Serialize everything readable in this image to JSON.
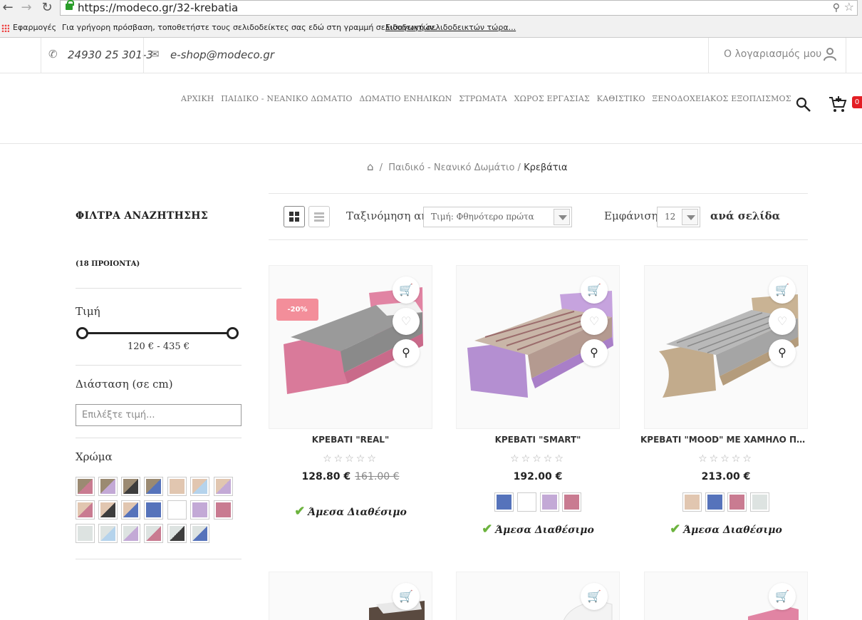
{
  "browser": {
    "url": "https://modeco.gr/32-krebatia",
    "apps_label": "Εφαρμογές",
    "bookmarks_hint": "Για γρήγορη πρόσβαση, τοποθετήστε τους σελιδοδείκτες σας εδώ στη γραμμή σελιδοδεικτών.",
    "bookmarks_link": "Εισαγωγή σελιδοδεικτών τώρα..."
  },
  "topbar": {
    "phone": "24930 25 301-3",
    "email": "e-shop@modeco.gr",
    "account": "Ο λογαριασμός μου"
  },
  "menu": [
    "ΑΡΧΙΚΗ",
    "ΠΑΙΔΙΚΟ - ΝΕΑΝΙΚΟ ΔΩΜΑΤΙΟ",
    "ΔΩΜΑΤΙΟ ΕΝΗΛΙΚΩΝ",
    "ΣΤΡΩΜΑΤΑ",
    "ΧΩΡΟΣ ΕΡΓΑΣΙΑΣ",
    "ΚΑΘΙΣΤΙΚΟ",
    "ΞΕΝΟΔΟΧΕΙΑΚΟΣ ΕΞΟΠΛΙΣΜΟΣ"
  ],
  "cart": {
    "count": "0"
  },
  "breadcrumb": {
    "parent": "Παιδικό - Νεανικό Δωμάτιο",
    "current": "Κρεβάτια"
  },
  "filters": {
    "title": "ΦΙΛΤΡΑ ΑΝΑΖΗΤΗΣΗΣ",
    "count": "(18 ΠΡΟΙΟΝΤΑ)",
    "price_label": "Τιμή",
    "price_range": "120 € - 435 €",
    "dimension_label": "Διάσταση (σε cm)",
    "dimension_placeholder": "Επιλέξτε τιμή...",
    "color_label": "Χρώμα"
  },
  "toolbar": {
    "sort_label": "Ταξινόμηση ανά",
    "sort_value": "Τιμή: Φθηνότερο πρώτα",
    "show_label": "Εμφάνιση",
    "show_value": "12",
    "per_page": "ανά σελίδα"
  },
  "colors": {
    "pink": "#c97b91",
    "lilac": "#c3a9d6",
    "oak": "#9b8a72",
    "dark": "#3d3d3d",
    "blue": "#5673bb",
    "beige": "#e1c6b0",
    "lightblue": "#b5d3ec",
    "lightgrey": "#dde3e1",
    "white": "#ffffff",
    "sale": "#f38e9a",
    "check": "#6cb33e"
  },
  "products": [
    {
      "name": "ΚΡΕΒΑΤΙ \"REAL\"",
      "price": "128.80 €",
      "old_price": "161.00 €",
      "discount": "-20%",
      "availability": "Άμεσα Διαθέσιμο"
    },
    {
      "name": "ΚΡΕΒΑΤΙ \"SMART\"",
      "price": "192.00 €",
      "old_price": "",
      "availability": "Άμεσα Διαθέσιμο"
    },
    {
      "name": "ΚΡΕΒΑΤΙ \"MOOD\" ΜΕ ΧΑΜΗΛΟ ΠΟΔ...",
      "price": "213.00 €",
      "old_price": "",
      "availability": "Άμεσα Διαθέσιμο"
    }
  ]
}
